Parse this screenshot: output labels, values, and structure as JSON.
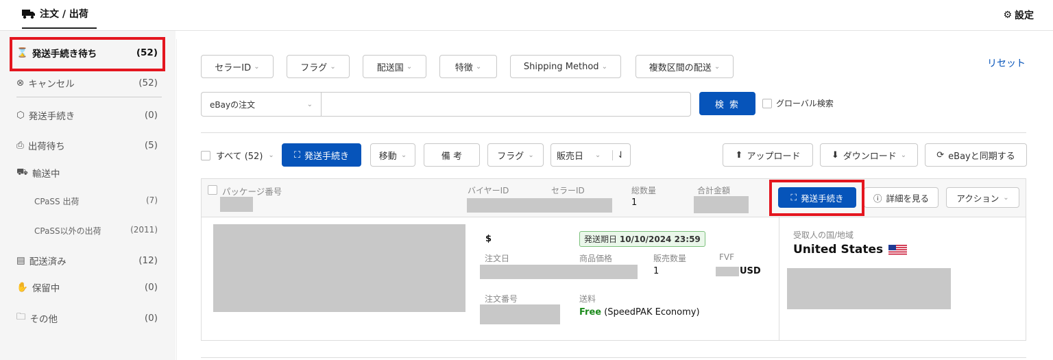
{
  "header": {
    "tab_label": "注文 / 出荷",
    "settings_label": "設定"
  },
  "sidebar": {
    "items": [
      {
        "label": "発送手続き待ち",
        "count": "(52)"
      },
      {
        "label": "キャンセル",
        "count": "(52)"
      },
      {
        "label": "発送手続き",
        "count": "(0)"
      },
      {
        "label": "出荷待ち",
        "count": "(5)"
      },
      {
        "label": "輸送中",
        "count": ""
      },
      {
        "label": "CPaSS 出荷",
        "count": "(7)"
      },
      {
        "label": "CPaSS以外の出荷",
        "count": "(2011)"
      },
      {
        "label": "配送済み",
        "count": "(12)"
      },
      {
        "label": "保留中",
        "count": "(0)"
      },
      {
        "label": "その他",
        "count": "(0)"
      }
    ]
  },
  "filters": {
    "seller_id": "セラーID",
    "flag": "フラグ",
    "ship_country": "配送国",
    "feature": "特徴",
    "shipping_method": "Shipping Method",
    "multi_leg": "複数区間の配送",
    "reset": "リセット"
  },
  "search": {
    "select_value": "eBayの注文",
    "input_value": "",
    "button": "検 索",
    "global_label": "グローバル検索"
  },
  "toolbar": {
    "all_label": "すべて (52)",
    "ship_button": "発送手続き",
    "move": "移動",
    "note": "備 考",
    "flag": "フラグ",
    "sale_date": "販売日",
    "upload": "アップロード",
    "download": "ダウンロード",
    "sync": "eBayと同期する"
  },
  "order": {
    "col_package": "パッケージ番号",
    "col_buyer": "バイヤーID",
    "col_seller": "セラーID",
    "col_total_qty": "総数量",
    "col_total_amount": "合計金額",
    "total_qty": "1",
    "ship_button": "発送手続き",
    "details_button": "詳細を見る",
    "action_button": "アクション",
    "currency_symbol": "$",
    "ship_deadline_label": "発送期日",
    "ship_deadline": "10/10/2024 23:59",
    "order_date_label": "注文日",
    "item_price_label": "商品価格",
    "qty_sold_label": "販売数量",
    "fvf_label": "FVF",
    "qty_sold": "1",
    "fvf_currency": "USD",
    "order_no_label": "注文番号",
    "shipping_label": "送料",
    "shipping_free": "Free",
    "shipping_service": " (SpeedPAK Economy)",
    "dest_label": "受取人の国/地域",
    "dest_country": "United States"
  },
  "colors": {
    "accent": "#0654ba",
    "highlight": "#e4161f",
    "free": "#1b8a1b"
  }
}
